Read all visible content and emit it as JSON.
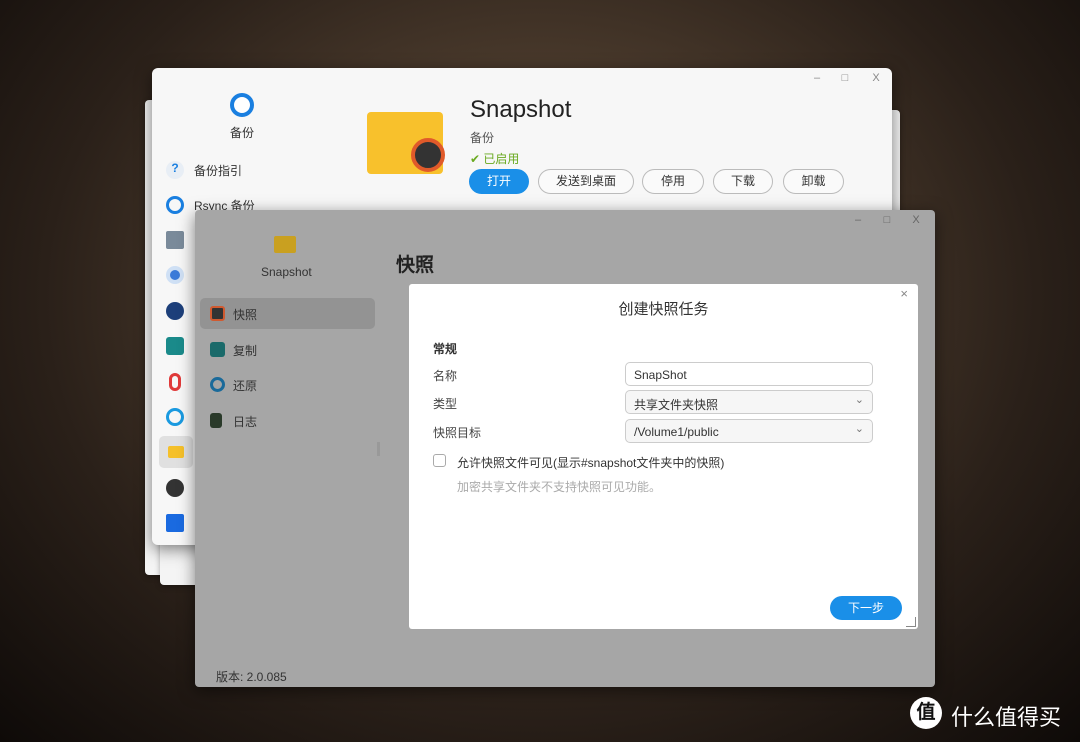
{
  "main_window": {
    "title": "Snapshot",
    "category": "备份",
    "status": "已启用",
    "sidebar_header": "备份",
    "sidebar_items": [
      "备份指引",
      "Rsync 备份"
    ],
    "buttons": {
      "open": "打开",
      "send_desktop": "发送到桌面",
      "disable": "停用",
      "download": "下载",
      "uninstall": "卸载"
    },
    "controls": {
      "minimize": "–",
      "maximize": "□",
      "close": "X"
    }
  },
  "snapshot_window": {
    "app_name": "Snapshot",
    "page_title": "快照",
    "nav": [
      "快照",
      "复制",
      "还原",
      "日志"
    ],
    "version": "版本: 2.0.085"
  },
  "dialog": {
    "title": "创建快照任务",
    "section": "常规",
    "name_label": "名称",
    "name_value": "SnapShot",
    "type_label": "类型",
    "type_value": "共享文件夹快照",
    "target_label": "快照目标",
    "target_value": "/Volume1/public",
    "checkbox_label": "允许快照文件可见(显示#snapshot文件夹中的快照)",
    "hint": "加密共享文件夹不支持快照可见功能。",
    "next": "下一步",
    "close": "×"
  },
  "watermark": {
    "icon_char": "值",
    "text": "什么值得买"
  },
  "colors": {
    "accent": "#1a8fe8",
    "status_green": "#6aaa20"
  }
}
